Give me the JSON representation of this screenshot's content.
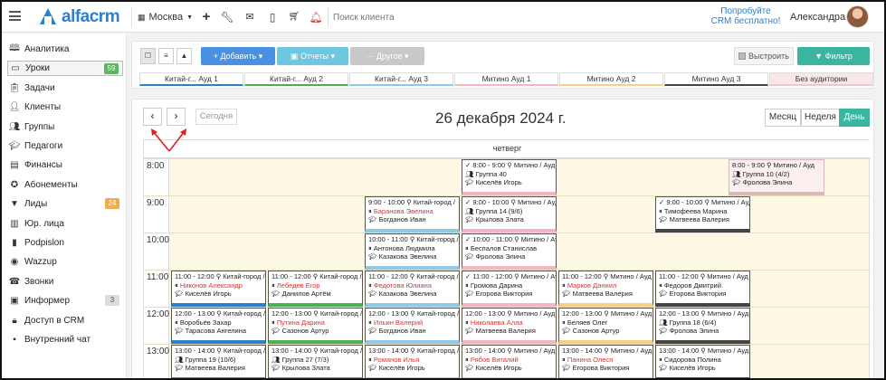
{
  "header": {
    "logo": "alfacrm",
    "city": "Москва",
    "search_placeholder": "Поиск клиента",
    "trial": "Попробуйте CRM бесплатно!",
    "user": "Александра",
    "icons": [
      "plus-icon",
      "wrench-icon",
      "mail-icon",
      "phone-icon",
      "cart-icon",
      "bell-icon"
    ]
  },
  "sidebar": {
    "items": [
      {
        "label": "Аналитика",
        "icon": "book-icon"
      },
      {
        "label": "Уроки",
        "icon": "board-icon",
        "badge": "59",
        "badge_color": "#5cb85c",
        "active": true
      },
      {
        "label": "Задачи",
        "icon": "clipboard-icon"
      },
      {
        "label": "Клиенты",
        "icon": "user-icon"
      },
      {
        "label": "Группы",
        "icon": "users-icon"
      },
      {
        "label": "Педагоги",
        "icon": "graduation-cap-icon"
      },
      {
        "label": "Финансы",
        "icon": "money-icon"
      },
      {
        "label": "Абонементы",
        "icon": "certificate-icon"
      },
      {
        "label": "Лиды",
        "icon": "funnel-icon",
        "badge": "24",
        "badge_color": "#f0ad4e"
      },
      {
        "label": "Юр. лица",
        "icon": "building-icon"
      },
      {
        "label": "Podpislon",
        "icon": "document-icon"
      },
      {
        "label": "Wazzup",
        "icon": "whatsapp-icon"
      },
      {
        "label": "Звонки",
        "icon": "phone-icon"
      },
      {
        "label": "Информер",
        "icon": "inbox-icon",
        "badge": "3",
        "badge_color": "#d9dde0"
      },
      {
        "label": "Доступ в CRM",
        "icon": "lock-icon"
      },
      {
        "label": "Внутренний чат",
        "icon": "chat-icon"
      }
    ]
  },
  "toolbar": {
    "add": "+ Добавить ▾",
    "reports": "Отчеты ▾",
    "other": "··· Другое ▾",
    "align": "Выстроить",
    "filter": "Фильтр",
    "colors": {
      "add": "#4a90e2",
      "reports": "#6fc6e0",
      "other": "#c8c8c8",
      "filter": "#3ab5a0"
    }
  },
  "rooms": [
    {
      "label": "Китай-г... Ауд 1",
      "color": "#2b7fd0"
    },
    {
      "label": "Китай-г... Ауд 2",
      "color": "#4caf50"
    },
    {
      "label": "Китай-г... Ауд 3",
      "color": "#8ec9e8"
    },
    {
      "label": "Митино Ауд 1",
      "color": "#f4b6c2"
    },
    {
      "label": "Митино Ауд 2",
      "color": "#f5d08a"
    },
    {
      "label": "Митино Ауд 3",
      "color": "#444444"
    },
    {
      "label": "Без аудитории",
      "color": "#f9e7e7"
    }
  ],
  "calendar": {
    "today": "Сегодня",
    "title": "26 декабря 2024 г.",
    "ranges": [
      "Месяц",
      "Неделя",
      "День"
    ],
    "active_range": "День",
    "weekday": "четверг",
    "hours": [
      "8:00",
      "9:00",
      "10:00",
      "11:00",
      "12:00",
      "13:00"
    ],
    "events": [
      {
        "col": 6,
        "start": 0,
        "l1": "8:00 - 9:00 ⚲ Митино / Ауд",
        "l2": "Группа 10 (4/2)",
        "l3": "Фролова Элина",
        "l2red": false,
        "bar": "#f9e7e7"
      },
      {
        "col": 3,
        "start": 0,
        "l1": "✓ 8:00 - 9:00 ⚲ Митино / Ауд 1",
        "l2": "Группа 40",
        "l3": "Киселёв Игорь",
        "l2red": false,
        "bar": "#f4b6c2"
      },
      {
        "col": 2,
        "start": 1,
        "l1": "9:00 - 10:00 ⚲ Китай-город /",
        "l2": "Баранова Эвелина",
        "l3": "Богданов Иван",
        "l2red": true,
        "bar": "#8ec9e8"
      },
      {
        "col": 3,
        "start": 1,
        "l1": "✓ 9:00 - 10:00 ⚲ Митино / Ауд 1",
        "l2": "Группа 14 (9/6)",
        "l3": "Крылова Злата",
        "l2red": false,
        "bar": "#f4b6c2"
      },
      {
        "col": 5,
        "start": 1,
        "l1": "✓ 9:00 - 10:00 ⚲ Митино / Ауд",
        "l2": "Тимофеева Марина",
        "l3": "Матвеева Валерия",
        "l2red": false,
        "bar": "#444444"
      },
      {
        "col": 2,
        "start": 2,
        "l1": "10:00 - 11:00 ⚲ Китай-город /",
        "l2": "Антонова Людмила",
        "l3": "Казакова Эвелина",
        "l2red": false,
        "bar": "#8ec9e8"
      },
      {
        "col": 3,
        "start": 2,
        "l1": "✓ 10:00 - 11:00 ⚲ Митино / Ауд 1",
        "l2": "Беспалов Станислав",
        "l3": "Фролова Элина",
        "l2red": false,
        "bar": "#f4b6c2"
      },
      {
        "col": 0,
        "start": 3,
        "l1": "11:00 - 12:00 ⚲ Китай-город /",
        "l2": "Никонов Александр",
        "l3": "Киселёв Игорь",
        "l2red": true,
        "bar": "#2b7fd0"
      },
      {
        "col": 1,
        "start": 3,
        "l1": "11:00 - 12:00 ⚲ Китай-город /",
        "l2": "Лебедев Егор",
        "l3": "Данилов Артём",
        "l2red": true,
        "bar": "#4caf50"
      },
      {
        "col": 2,
        "start": 3,
        "l1": "11:00 - 12:00 ⚲ Китай-город /",
        "l2": "Федотова Юлиана",
        "l3": "Казакова Эвелина",
        "l2red": true,
        "bar": "#8ec9e8"
      },
      {
        "col": 3,
        "start": 3,
        "l1": "✓ 11:00 - 12:00 ⚲ Митино / Ауд 1",
        "l2": "Громова Дарина",
        "l3": "Егорова Виктория",
        "l2red": false,
        "bar": "#f4b6c2"
      },
      {
        "col": 4,
        "start": 3,
        "l1": "11:00 - 12:00 ⚲ Митино / Ауд",
        "l2": "Марков Даниил",
        "l3": "Матвеева Валерия",
        "l2red": true,
        "bar": "#f5d08a"
      },
      {
        "col": 5,
        "start": 3,
        "l1": "11:00 - 12:00 ⚲ Митино / Ауд",
        "l2": "Федоров Дмитрий",
        "l3": "Егорова Виктория",
        "l2red": false,
        "bar": "#444444"
      },
      {
        "col": 0,
        "start": 4,
        "l1": "12:00 - 13:00 ⚲ Китай-город /",
        "l2": "Воробьёв Захар",
        "l3": "Тарасова Ангелина",
        "l2red": false,
        "bar": "#2b7fd0"
      },
      {
        "col": 1,
        "start": 4,
        "l1": "12:00 - 13:00 ⚲ Китай-город /",
        "l2": "Путина Дарина",
        "l3": "Сазонов Артур",
        "l2red": true,
        "bar": "#4caf50"
      },
      {
        "col": 2,
        "start": 4,
        "l1": "12:00 - 13:00 ⚲ Китай-город /",
        "l2": "Ильин Валерий",
        "l3": "Богданов Иван",
        "l2red": true,
        "bar": "#8ec9e8"
      },
      {
        "col": 3,
        "start": 4,
        "l1": "12:00 - 13:00 ⚲ Митино / Ауд 1",
        "l2": "Николаева Алла",
        "l3": "Матвеева Валерия",
        "l2red": true,
        "bar": "#f4b6c2"
      },
      {
        "col": 4,
        "start": 4,
        "l1": "12:00 - 13:00 ⚲ Митино / Ауд",
        "l2": "Беляев Олег",
        "l3": "Сазонов Артур",
        "l2red": false,
        "bar": "#f5d08a"
      },
      {
        "col": 5,
        "start": 4,
        "l1": "12:00 - 13:00 ⚲ Митино / Ауд",
        "l2": "Группа 18 (6/4)",
        "l3": "Фролова Элина",
        "l2red": false,
        "bar": "#444444"
      },
      {
        "col": 0,
        "start": 5,
        "l1": "13:00 - 14:00 ⚲ Китай-город /",
        "l2": "Группа 19 (10/6)",
        "l3": "Матвеева Валерия",
        "l2red": false,
        "bar": "#2b7fd0"
      },
      {
        "col": 1,
        "start": 5,
        "l1": "13:00 - 14:00 ⚲ Китай-город /",
        "l2": "Группа 27 (7/3)",
        "l3": "Крылова Злата",
        "l2red": false,
        "bar": "#4caf50"
      },
      {
        "col": 2,
        "start": 5,
        "l1": "13:00 - 14:00 ⚲ Китай-город /",
        "l2": "Романов Илья",
        "l3": "Киселёв Игорь",
        "l2red": true,
        "bar": "#8ec9e8"
      },
      {
        "col": 3,
        "start": 5,
        "l1": "13:00 - 14:00 ⚲ Митино / Ауд 1",
        "l2": "Рябов Виталий",
        "l3": "Киселёв Игорь",
        "l2red": true,
        "bar": "#f4b6c2"
      },
      {
        "col": 4,
        "start": 5,
        "l1": "13:00 - 14:00 ⚲ Митино / Ауд",
        "l2": "Панина Олеся",
        "l3": "Егорова Виктория",
        "l2red": true,
        "bar": "#f5d08a"
      },
      {
        "col": 5,
        "start": 5,
        "l1": "13:00 - 14:00 ⚲ Митино / Ауд",
        "l2": "Сидорова Полина",
        "l3": "Киселёв Игорь",
        "l2red": false,
        "bar": "#444444"
      }
    ]
  }
}
